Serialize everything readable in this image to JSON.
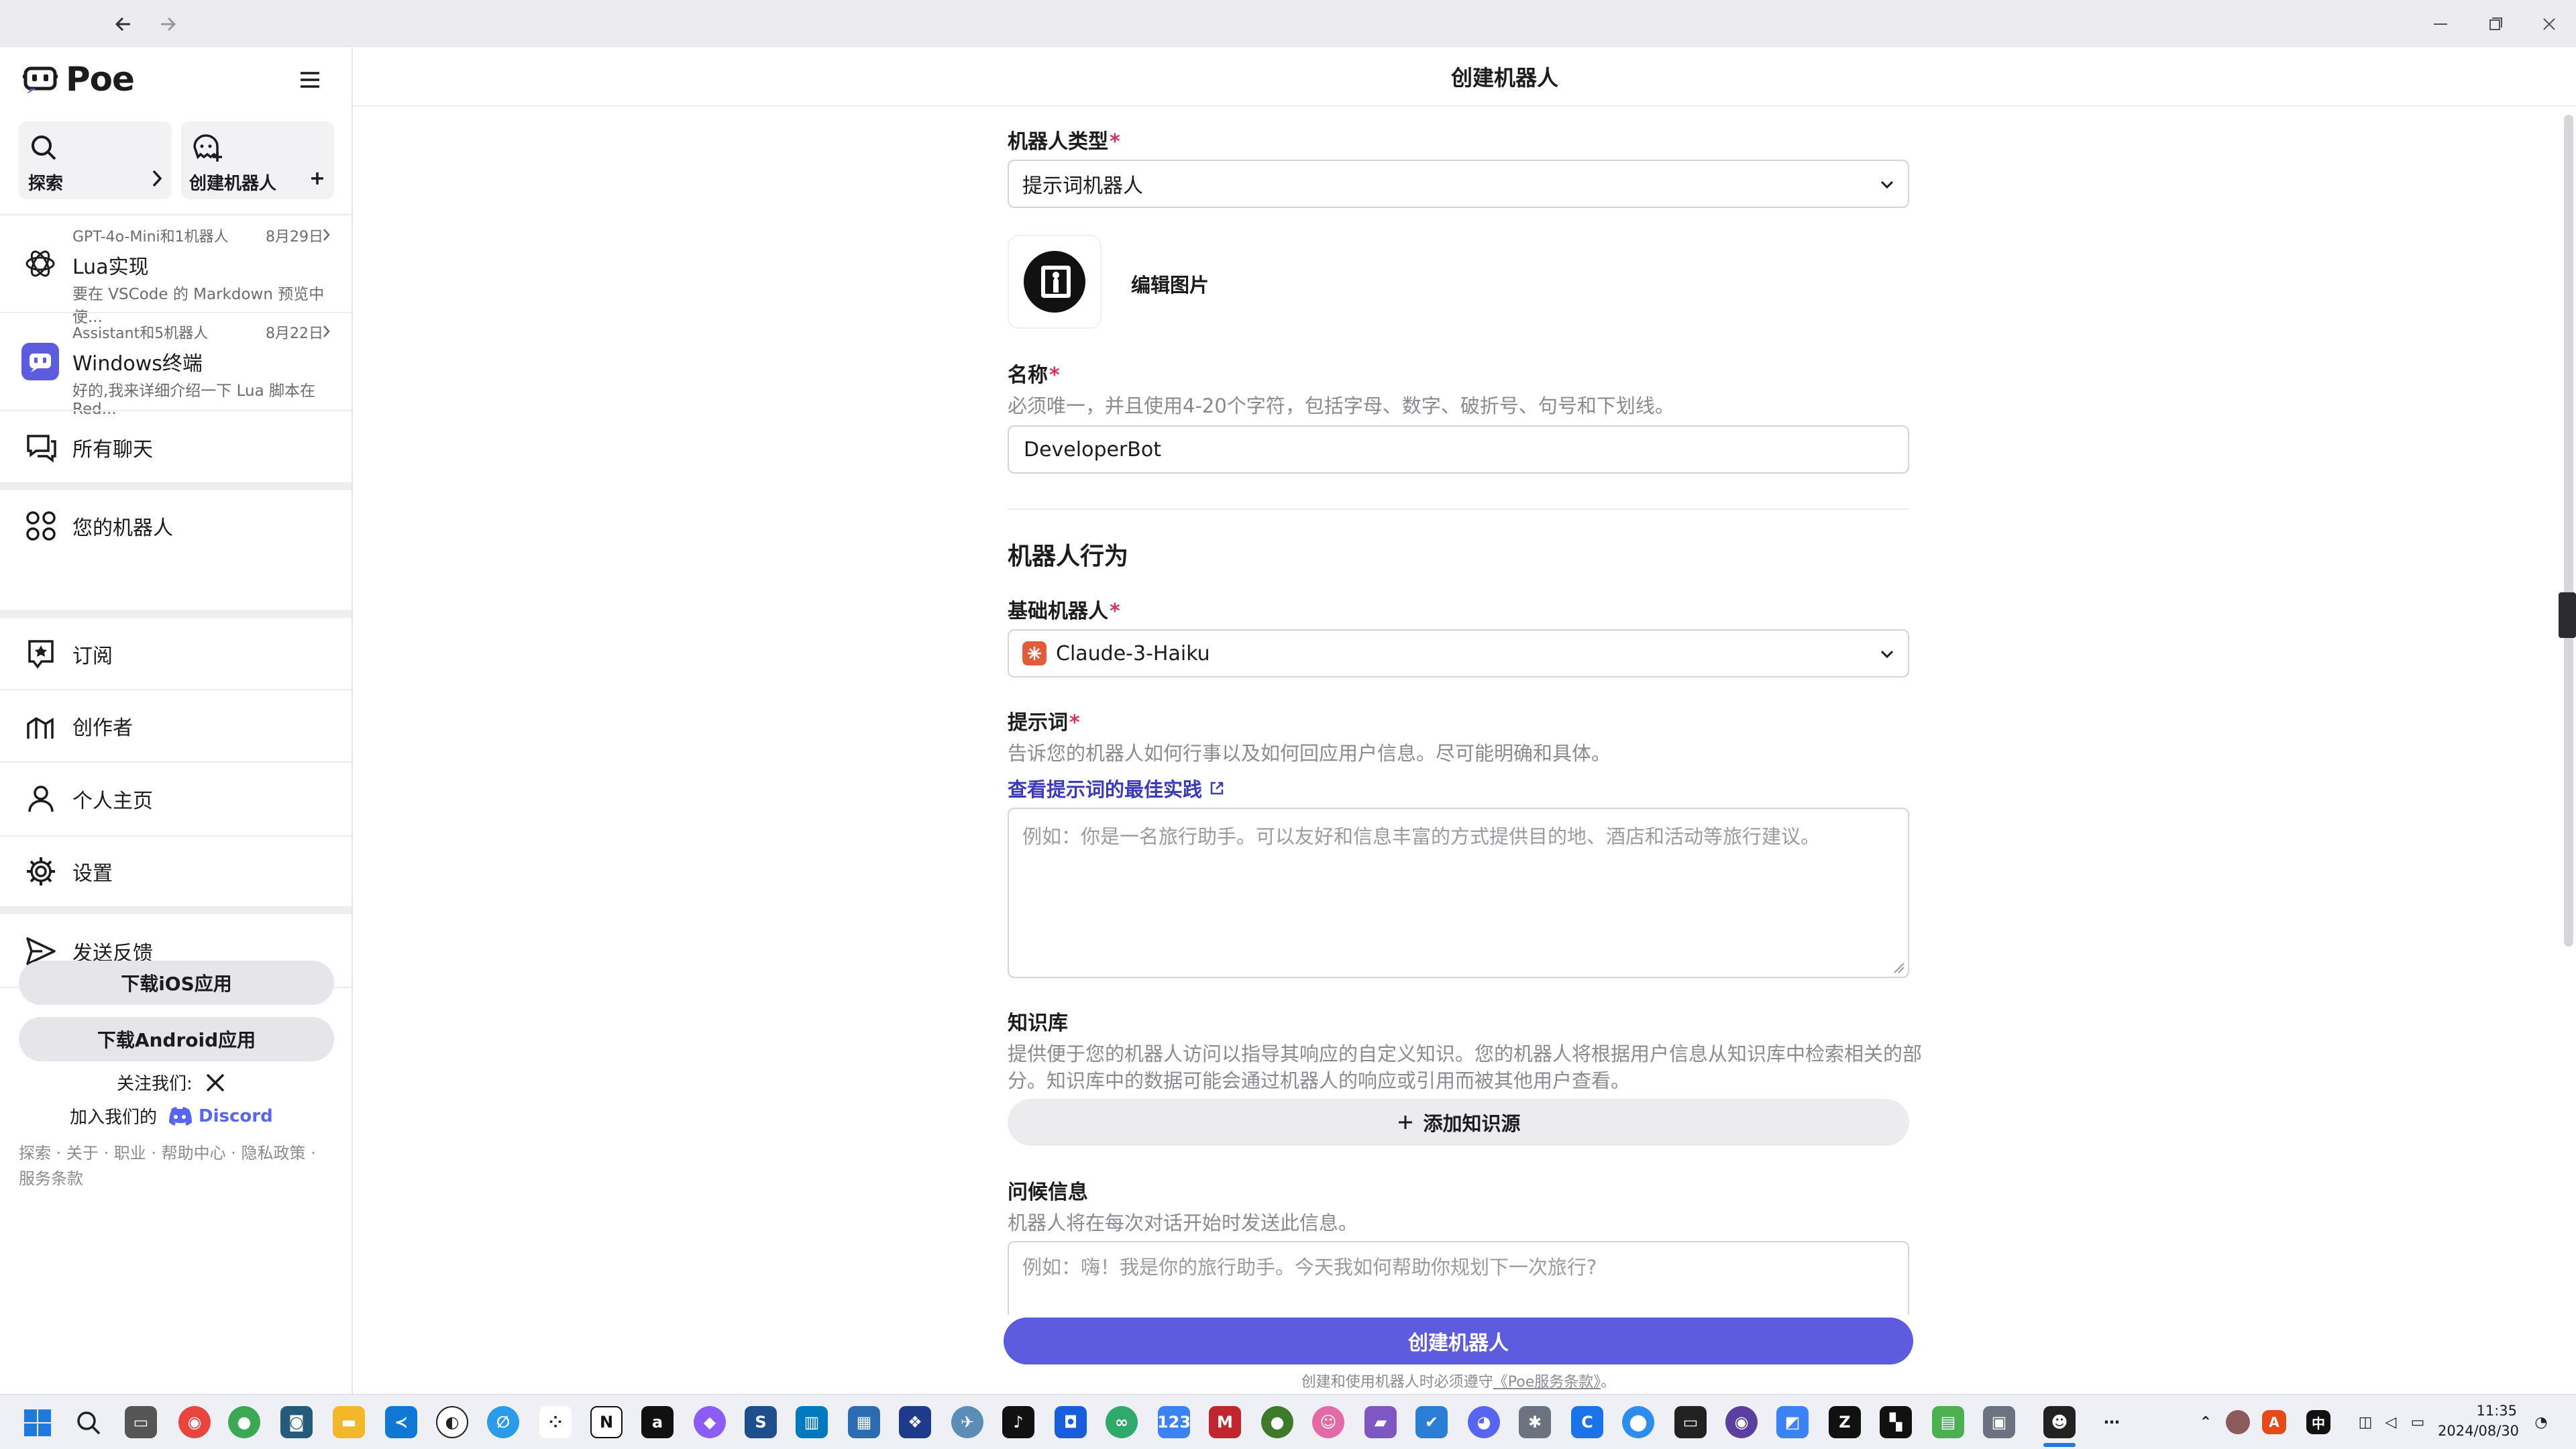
{
  "app": {
    "name": "Poe"
  },
  "header": {
    "title": "创建机器人"
  },
  "sidebar": {
    "explore_label": "探索",
    "create_label": "创建机器人",
    "chats": [
      {
        "meta": "GPT-4o-Mini和1机器人",
        "date": "8月29日",
        "title": "Lua实现",
        "preview": "要在 VSCode 的 Markdown 预览中使..."
      },
      {
        "meta": "Assistant和5机器人",
        "date": "8月22日",
        "title": "Windows终端",
        "preview": "好的,我来详细介绍一下 Lua 脚本在 Red..."
      }
    ],
    "nav": {
      "all_chats": "所有聊天",
      "your_bots": "您的机器人",
      "subscribe": "订阅",
      "creators": "创作者",
      "profile": "个人主页",
      "settings": "设置",
      "feedback": "发送反馈"
    },
    "download_ios": "下载iOS应用",
    "download_android": "下载Android应用",
    "follow_us": "关注我们:",
    "join_us": "加入我们的",
    "discord": "Discord",
    "footer_links": "探索 · 关于 · 职业 · 帮助中心 · 隐私政策 ·",
    "footer_links2": "服务条款"
  },
  "form": {
    "bot_type_label": "机器人类型",
    "bot_type_value": "提示词机器人",
    "edit_image": "编辑图片",
    "name_label": "名称",
    "name_help": "必须唯一，并且使用4-20个字符，包括字母、数字、破折号、句号和下划线。",
    "name_value": "DeveloperBot",
    "behavior_heading": "机器人行为",
    "base_bot_label": "基础机器人",
    "base_bot_value": "Claude-3-Haiku",
    "prompt_label": "提示词",
    "prompt_help": "告诉您的机器人如何行事以及如何回应用户信息。尽可能明确和具体。",
    "prompt_link": "查看提示词的最佳实践",
    "prompt_placeholder": "例如：你是一名旅行助手。可以友好和信息丰富的方式提供目的地、酒店和活动等旅行建议。",
    "kb_label": "知识库",
    "kb_help1": "提供便于您的机器人访问以指导其响应的自定义知识。您的机器人将根据用户信息从知识库中检索相关的部",
    "kb_help2": "分。知识库中的数据可能会通过机器人的响应或引用而被其他用户查看。",
    "kb_button": "添加知识源",
    "greeting_label": "问候信息",
    "greeting_help": "机器人将在每次对话开始时发送此信息。",
    "greeting_placeholder": "例如：嗨！我是你的旅行助手。今天我如何帮助你规划下一次旅行?",
    "create_button": "创建机器人",
    "terms_prefix": "创建和使用机器人时必须遵守",
    "terms_link": "《Poe服务条款》",
    "terms_suffix": "。"
  },
  "taskbar": {
    "time": "11:35",
    "date": "2024/08/30"
  },
  "colors": {
    "accent": "#5d5cde",
    "required": "#d9325c",
    "link": "#3b3ab8"
  }
}
